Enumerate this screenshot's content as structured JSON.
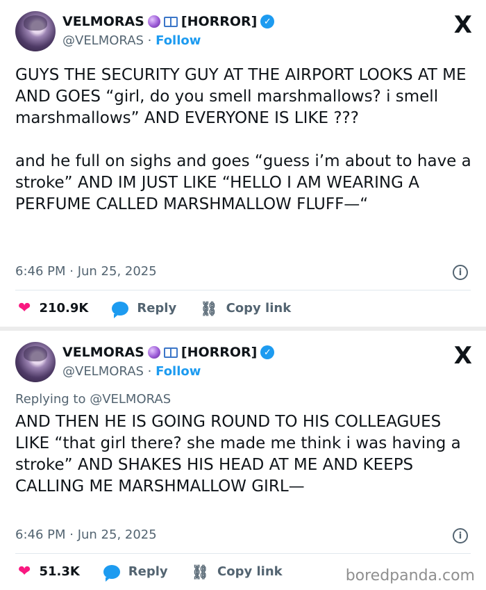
{
  "tweets": [
    {
      "author": {
        "name": "VELMORAS",
        "tag": "HORROR",
        "handle": "@VELMORAS",
        "follow_label": "Follow"
      },
      "replying_to": "",
      "text": "GUYS THE SECURITY GUY AT THE AIRPORT LOOKS AT ME AND GOES “girl, do you smell marshmallows? i smell marshmallows” AND EVERYONE IS LIKE ???\n\nand he full on sighs and goes “guess i’m about to have a stroke” AND IM JUST LIKE “HELLO I AM WEARING A PERFUME CALLED MARSHMALLOW FLUFF—“",
      "timestamp": "6:46 PM · Jun 25, 2025",
      "likes": "210.9K",
      "reply_label": "Reply",
      "copy_link_label": "Copy link"
    },
    {
      "author": {
        "name": "VELMORAS",
        "tag": "HORROR",
        "handle": "@VELMORAS",
        "follow_label": "Follow"
      },
      "replying_to": "Replying to @VELMORAS",
      "text": "AND THEN HE IS GOING ROUND TO HIS COLLEAGUES LIKE “that girl there? she made me think i was having a stroke” AND SHAKES HIS HEAD AT ME AND KEEPS CALLING ME MARSHMALLOW GIRL—",
      "timestamp": "6:46 PM · Jun 25, 2025",
      "likes": "51.3K",
      "reply_label": "Reply",
      "copy_link_label": "Copy link"
    }
  ],
  "icons": {
    "x": "X",
    "verified": "✓",
    "info": "i",
    "heart": "❤",
    "link": "⛓"
  },
  "watermark": "boredpanda.com",
  "colors": {
    "accent": "#1d9bf0",
    "like": "#f91880",
    "muted": "#536471"
  }
}
